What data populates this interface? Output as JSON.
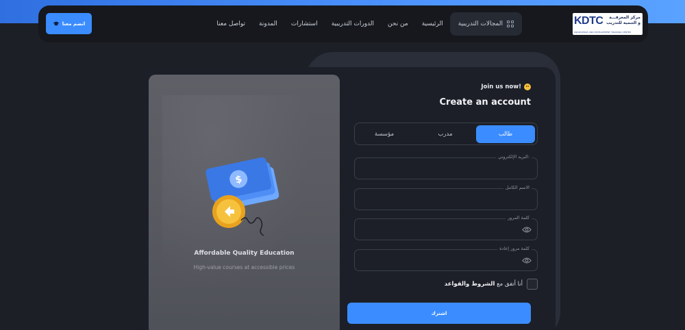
{
  "header": {
    "join_button_label": "انضم معنا",
    "nav": [
      {
        "label": "المجالات التدريبية"
      },
      {
        "label": "الرئيسية"
      },
      {
        "label": "من نحن"
      },
      {
        "label": "الدورات التدريبية"
      },
      {
        "label": "استشارات"
      },
      {
        "label": "المدونة"
      },
      {
        "label": "تواصل معنا"
      }
    ],
    "logo": {
      "mark": "KDTC",
      "arabic_line1": "مركز المعرفـــة",
      "arabic_line2": "و التنمية للتدريب",
      "english": "KNOWLEDGE AND DEVELOPMENT TRAINING CENTER"
    }
  },
  "promo": {
    "title": "Affordable Quality Education",
    "subtitle": "High-value courses at accessible prices"
  },
  "form": {
    "join_now": "Join us now!",
    "title": "Create an account",
    "tabs": [
      {
        "label": "طالب",
        "selected": true
      },
      {
        "label": "مدرب",
        "selected": false
      },
      {
        "label": "مؤسسة",
        "selected": false
      }
    ],
    "fields": [
      {
        "label": "البريد الإلكتروني:",
        "value": ""
      },
      {
        "label": "الاسم الكامل",
        "value": ""
      },
      {
        "label": "كلمة المرور",
        "value": ""
      },
      {
        "label": "كلمة مرور إعادة",
        "value": ""
      }
    ],
    "agree_prefix": "أنا أتفق مع",
    "agree_link": "الشروط والقواعد",
    "submit_label": "اشترك"
  },
  "colors": {
    "accent": "#3b8cff",
    "background": "#1d1f26",
    "card": "#1c1f27"
  }
}
